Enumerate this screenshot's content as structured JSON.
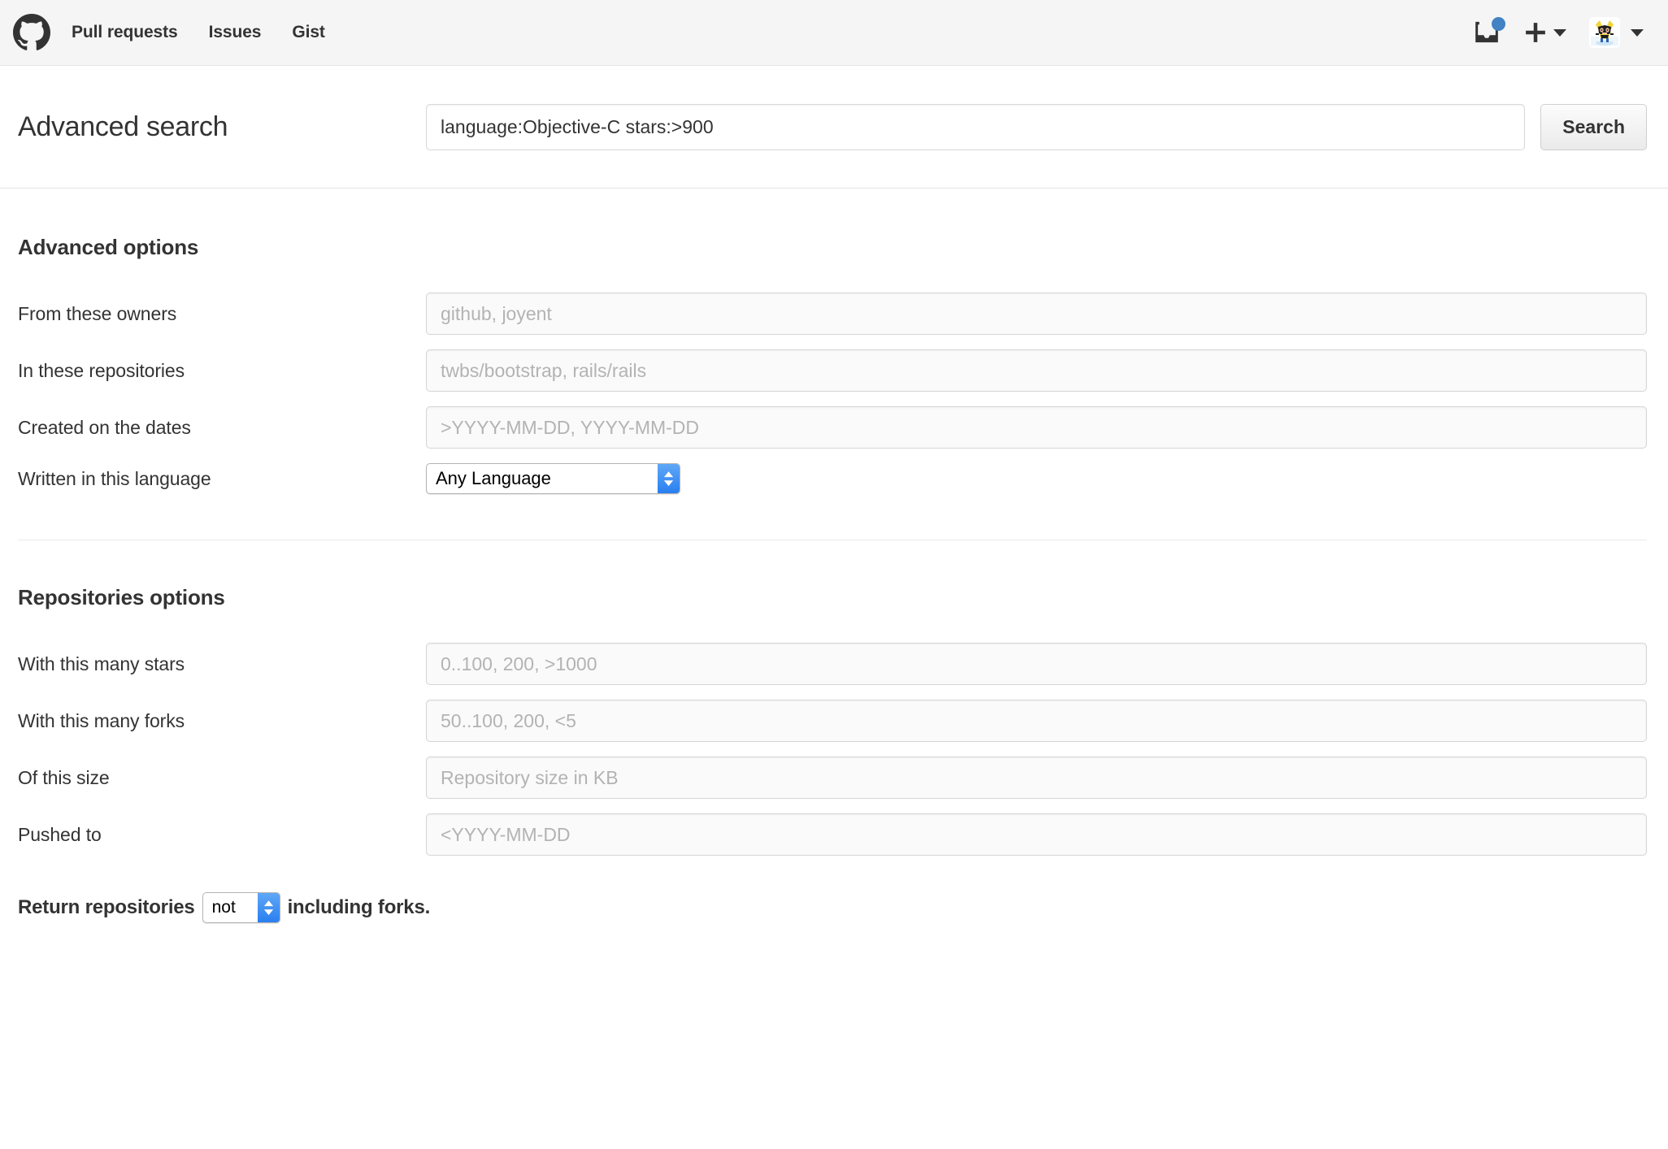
{
  "header": {
    "logo_icon": "github-mark-icon",
    "nav": [
      {
        "label": "Pull requests",
        "name": "nav-pull-requests"
      },
      {
        "label": "Issues",
        "name": "nav-issues"
      },
      {
        "label": "Gist",
        "name": "nav-gist"
      }
    ],
    "inbox_icon": "inbox-icon",
    "notification_dot_color": "#4183c4",
    "create_new_icon": "plus-icon",
    "avatar_icon": "user-avatar",
    "dropdown_icon": "chevron-down-icon"
  },
  "search": {
    "title": "Advanced search",
    "query_value": "language:Objective-C stars:>900",
    "submit_label": "Search"
  },
  "advanced_options": {
    "section_title": "Advanced options",
    "fields": [
      {
        "label": "From these owners",
        "placeholder": "github, joyent",
        "name": "owners"
      },
      {
        "label": "In these repositories",
        "placeholder": "twbs/bootstrap, rails/rails",
        "name": "repositories"
      },
      {
        "label": "Created on the dates",
        "placeholder": ">YYYY-MM-DD, YYYY-MM-DD",
        "name": "created-dates"
      }
    ],
    "language": {
      "label": "Written in this language",
      "selected": "Any Language"
    }
  },
  "repositories_options": {
    "section_title": "Repositories options",
    "fields": [
      {
        "label": "With this many stars",
        "placeholder": "0..100, 200, >1000",
        "name": "stars"
      },
      {
        "label": "With this many forks",
        "placeholder": "50..100, 200, <5",
        "name": "forks"
      },
      {
        "label": "Of this size",
        "placeholder": "Repository size in KB",
        "name": "size"
      },
      {
        "label": "Pushed to",
        "placeholder": "<YYYY-MM-DD",
        "name": "pushed-to"
      }
    ],
    "forks_statement": {
      "prefix": "Return repositories",
      "selected": "not",
      "suffix": "including forks."
    }
  }
}
